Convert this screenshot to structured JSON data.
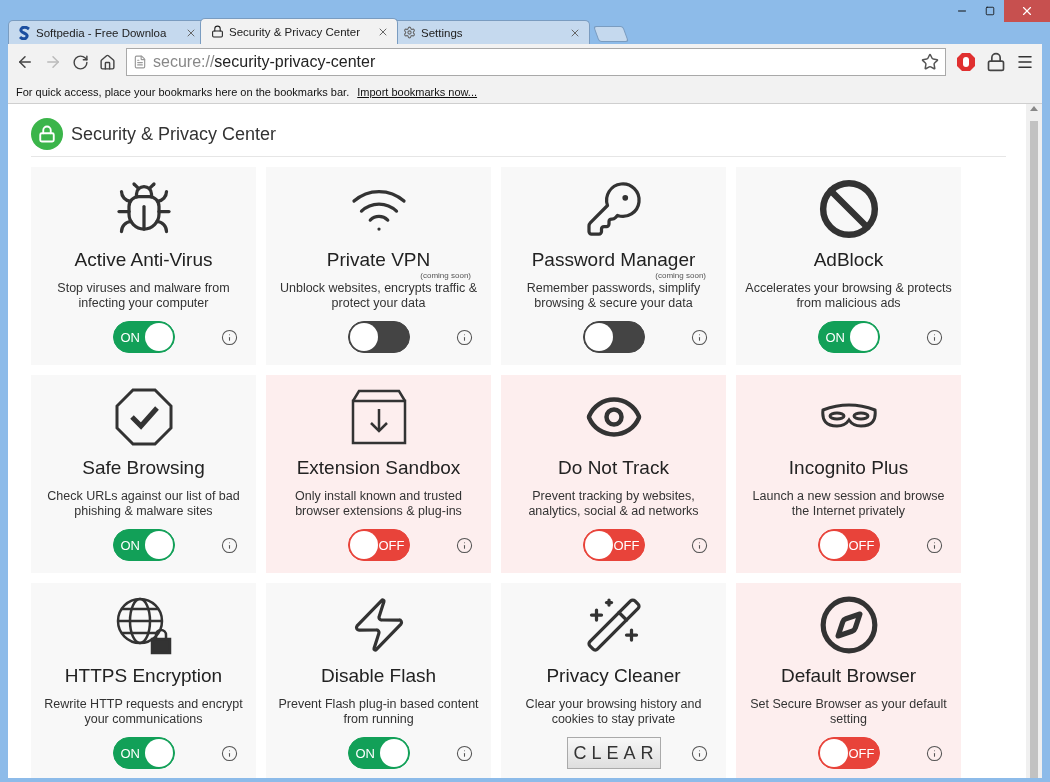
{
  "tabs": [
    {
      "label": "Softpedia - Free Downloa",
      "selected": false
    },
    {
      "label": "Security & Privacy Center",
      "selected": true
    },
    {
      "label": "Settings",
      "selected": false
    }
  ],
  "address_bar": {
    "scheme": "secure://",
    "path": "security-privacy-center"
  },
  "bookmarks_bar": {
    "text": "For quick access, place your bookmarks here on the bookmarks bar.",
    "link": "Import bookmarks now..."
  },
  "page": {
    "title": "Security & Privacy Center"
  },
  "cards": [
    {
      "title": "Active Anti-Virus",
      "description": "Stop viruses and malware from infecting your computer",
      "kind": "toggle",
      "on": true,
      "disabled": false,
      "label": "ON"
    },
    {
      "title": "Private VPN",
      "note": "(coming soon)",
      "description": "Unblock websites, encrypts traffic & protect your data",
      "kind": "toggle",
      "on": false,
      "disabled": true
    },
    {
      "title": "Password Manager",
      "note": "(coming soon)",
      "description": "Remember passwords, simplify browsing & secure your data",
      "kind": "toggle",
      "on": false,
      "disabled": true
    },
    {
      "title": "AdBlock",
      "description": "Accelerates your browsing & protects from malicious ads",
      "kind": "toggle",
      "on": true,
      "disabled": false,
      "label": "ON"
    },
    {
      "title": "Safe Browsing",
      "description": "Check URLs against our list of bad phishing & malware sites",
      "kind": "toggle",
      "on": true,
      "disabled": false,
      "label": "ON"
    },
    {
      "title": "Extension Sandbox",
      "description": "Only install known and trusted browser extensions & plug-ins",
      "kind": "toggle",
      "on": false,
      "disabled": false,
      "label": "OFF"
    },
    {
      "title": "Do Not Track",
      "description": "Prevent tracking by websites, analytics, social & ad networks",
      "kind": "toggle",
      "on": false,
      "disabled": false,
      "label": "OFF"
    },
    {
      "title": "Incognito Plus",
      "description": "Launch a new session and browse the Internet privately",
      "kind": "toggle",
      "on": false,
      "disabled": false,
      "label": "OFF"
    },
    {
      "title": "HTTPS Encryption",
      "description": "Rewrite HTTP requests and encrypt your communications",
      "kind": "toggle",
      "on": true,
      "disabled": false,
      "label": "ON"
    },
    {
      "title": "Disable Flash",
      "description": "Prevent Flash plug-in based content from running",
      "kind": "toggle",
      "on": true,
      "disabled": false,
      "label": "ON"
    },
    {
      "title": "Privacy Cleaner",
      "description": "Clear your browsing history and cookies to stay private",
      "kind": "button",
      "button": "CLEAR"
    },
    {
      "title": "Default Browser",
      "description": "Set Secure Browser as your default setting",
      "kind": "toggle",
      "on": false,
      "disabled": false,
      "label": "OFF"
    }
  ]
}
